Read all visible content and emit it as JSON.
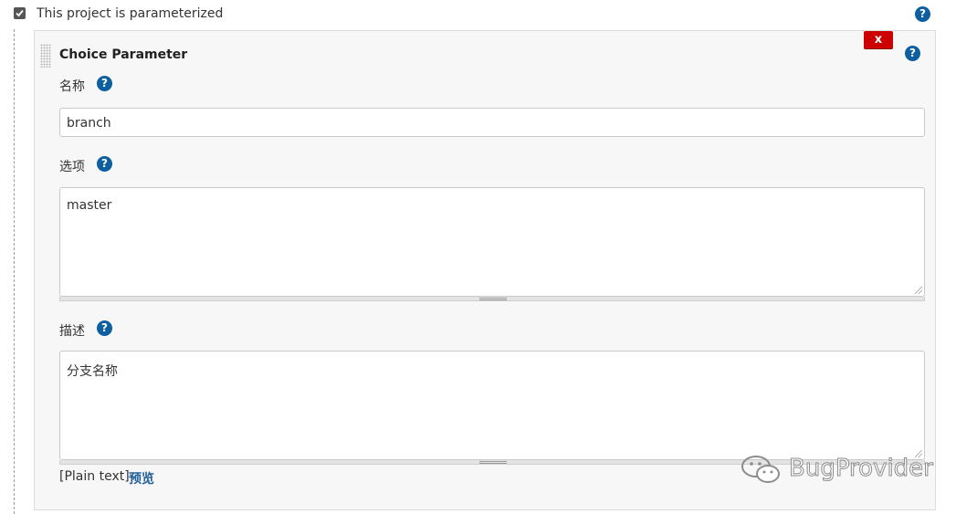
{
  "parameterized": {
    "checked": true,
    "label": "This project is parameterized"
  },
  "choice_parameter": {
    "title": "Choice Parameter",
    "delete_label": "x",
    "name_label": "名称",
    "name_value": "branch",
    "choices_label": "选项",
    "choices_value": "master",
    "description_label": "描述",
    "description_value": "分支名称",
    "format_label": "[Plain text]",
    "preview_label": "预览"
  },
  "help_glyph": "?",
  "watermark": {
    "text": "BugProvider",
    "icon": "wechat-icon"
  },
  "colors": {
    "help": "#0d5fa0",
    "delete": "#cc0000",
    "link": "#1f5d99",
    "panel": "#f7f7f7"
  }
}
